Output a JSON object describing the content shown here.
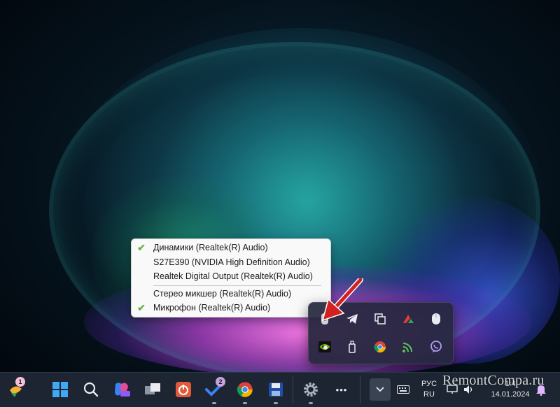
{
  "context_menu": {
    "items": [
      {
        "label": "Динамики (Realtek(R) Audio)",
        "checked": true
      },
      {
        "label": "S27E390 (NVIDIA High Definition Audio)",
        "checked": false
      },
      {
        "label": "Realtek Digital Output (Realtek(R) Audio)",
        "checked": false
      },
      {
        "label": "Стерео микшер (Realtek(R) Audio)",
        "checked": false
      },
      {
        "label": "Микрофон (Realtek(R) Audio)",
        "checked": true
      }
    ],
    "check_glyph": "✔"
  },
  "tray_icons": [
    "audio-switcher-icon",
    "telegram-icon",
    "copy-icon",
    "arrow-logo-icon",
    "mouse-icon",
    "nvidia-icon",
    "usb-drive-icon",
    "chrome-icon",
    "wifi-signal-icon",
    "viber-icon"
  ],
  "taskbar": {
    "widget_badge": "1",
    "todo_badge": "2",
    "overflow_glyph": "•••",
    "language": {
      "line1": "РУС",
      "line2": "RU"
    },
    "clock": {
      "time": "1:4",
      "date": "14.01.2024"
    },
    "icons": [
      "widgets-icon",
      "start-icon",
      "search-icon",
      "copilot-icon",
      "task-view-icon",
      "power-app-icon",
      "todo-icon",
      "chrome-icon",
      "save-app-icon",
      "settings-icon",
      "more-icon",
      "tray-chevron-icon",
      "keyboard-icon",
      "network-icon",
      "volume-icon",
      "bell-icon"
    ]
  },
  "watermark": "RemontCompa.ru",
  "colors": {
    "check": "#6ab04c",
    "arrow": "#d32020",
    "taskbar": "#1c2531",
    "tray": "#26283e"
  }
}
